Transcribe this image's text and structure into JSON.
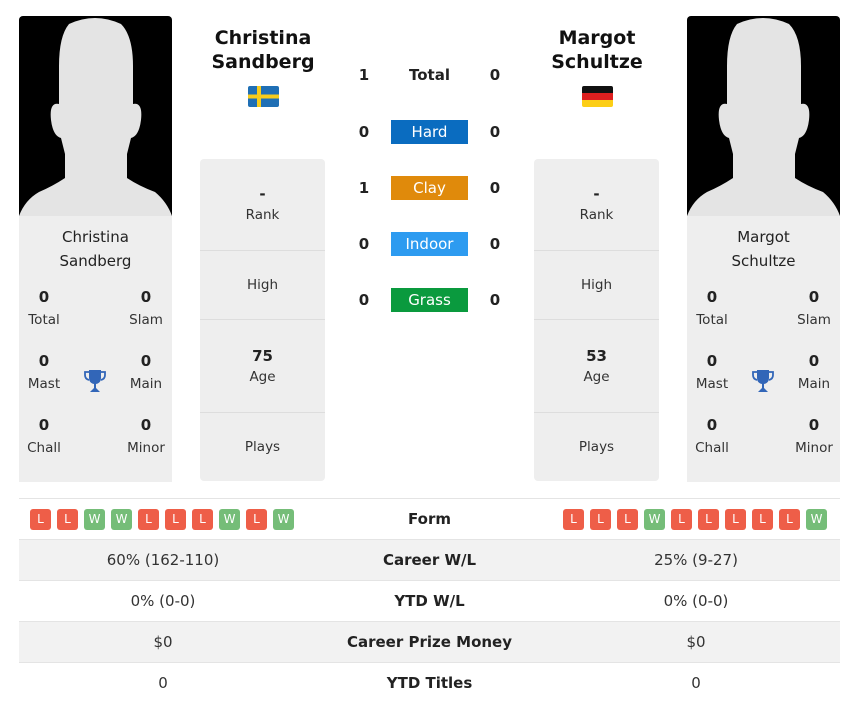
{
  "colors": {
    "hard": "#0a6cc0",
    "clay": "#e08a0b",
    "indoor": "#2d9bf0",
    "grass": "#0a9a3e",
    "loss": "#ee5e48",
    "win": "#75bd78",
    "trophy": "#3266b8"
  },
  "player1": {
    "header_name_line1": "Christina",
    "header_name_line2": "Sandberg",
    "flag": "sweden-flag",
    "card_name_line1": "Christina",
    "card_name_line2": "Sandberg",
    "titles": {
      "total": {
        "value": "0",
        "label": "Total"
      },
      "slam": {
        "value": "0",
        "label": "Slam"
      },
      "mast": {
        "value": "0",
        "label": "Mast"
      },
      "main": {
        "value": "0",
        "label": "Main"
      },
      "chall": {
        "value": "0",
        "label": "Chall"
      },
      "minor": {
        "value": "0",
        "label": "Minor"
      }
    },
    "info": {
      "rank": {
        "value": "-",
        "label": "Rank"
      },
      "high": {
        "value": "",
        "label": "High"
      },
      "age": {
        "value": "75",
        "label": "Age"
      },
      "plays": {
        "value": "",
        "label": "Plays"
      }
    },
    "form": [
      "L",
      "L",
      "W",
      "W",
      "L",
      "L",
      "L",
      "W",
      "L",
      "W"
    ],
    "career_wl": "60% (162-110)",
    "ytd_wl": "0% (0-0)",
    "career_prize": "$0",
    "ytd_titles": "0"
  },
  "player2": {
    "header_name_line1": "Margot",
    "header_name_line2": "Schultze",
    "flag": "germany-flag",
    "card_name_line1": "Margot",
    "card_name_line2": "Schultze",
    "titles": {
      "total": {
        "value": "0",
        "label": "Total"
      },
      "slam": {
        "value": "0",
        "label": "Slam"
      },
      "mast": {
        "value": "0",
        "label": "Mast"
      },
      "main": {
        "value": "0",
        "label": "Main"
      },
      "chall": {
        "value": "0",
        "label": "Chall"
      },
      "minor": {
        "value": "0",
        "label": "Minor"
      }
    },
    "info": {
      "rank": {
        "value": "-",
        "label": "Rank"
      },
      "high": {
        "value": "",
        "label": "High"
      },
      "age": {
        "value": "53",
        "label": "Age"
      },
      "plays": {
        "value": "",
        "label": "Plays"
      }
    },
    "form": [
      "L",
      "L",
      "L",
      "W",
      "L",
      "L",
      "L",
      "L",
      "L",
      "W"
    ],
    "career_wl": "25% (9-27)",
    "ytd_wl": "0% (0-0)",
    "career_prize": "$0",
    "ytd_titles": "0"
  },
  "h2h": [
    {
      "surface": "Total",
      "p1": "1",
      "p2": "0"
    },
    {
      "surface": "Hard",
      "p1": "0",
      "p2": "0"
    },
    {
      "surface": "Clay",
      "p1": "1",
      "p2": "0"
    },
    {
      "surface": "Indoor",
      "p1": "0",
      "p2": "0"
    },
    {
      "surface": "Grass",
      "p1": "0",
      "p2": "0"
    }
  ],
  "table_labels": {
    "form": "Form",
    "career_wl": "Career W/L",
    "ytd_wl": "YTD W/L",
    "career_prize": "Career Prize Money",
    "ytd_titles": "YTD Titles"
  }
}
